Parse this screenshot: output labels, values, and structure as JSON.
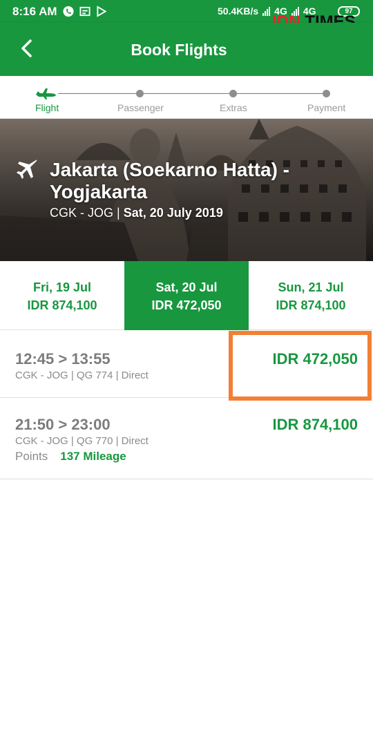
{
  "status_bar": {
    "time": "8:16 AM",
    "network_speed": "50.4KB/s",
    "network_type_1": "4G",
    "network_type_2": "4G",
    "battery": "97"
  },
  "watermark": {
    "part_a": "IDN",
    "part_b": "TIMES"
  },
  "header": {
    "title": "Book Flights",
    "back_icon": "chevron-left-icon"
  },
  "stepper": {
    "steps": [
      {
        "label": "Flight",
        "active": true
      },
      {
        "label": "Passenger",
        "active": false
      },
      {
        "label": "Extras",
        "active": false
      },
      {
        "label": "Payment",
        "active": false
      }
    ]
  },
  "route": {
    "title": "Jakarta (Soekarno Hatta) - Yogjakarta",
    "codes": "CGK - JOG",
    "separator": "|",
    "date": "Sat, 20 July 2019",
    "icon": "airplane-icon"
  },
  "date_tabs": [
    {
      "date": "Fri, 19 Jul",
      "price": "IDR 874,100",
      "selected": false
    },
    {
      "date": "Sat, 20 Jul",
      "price": "IDR 472,050",
      "selected": true
    },
    {
      "date": "Sun, 21 Jul",
      "price": "IDR 874,100",
      "selected": false
    }
  ],
  "flights": [
    {
      "time": "12:45 > 13:55",
      "details": "CGK - JOG | QG 774 | Direct",
      "price": "IDR 472,050"
    },
    {
      "time": "21:50 > 23:00",
      "details": "CGK - JOG | QG 770 | Direct",
      "price": "IDR 874,100",
      "points_label": "Points",
      "points_value": "137 Mileage"
    }
  ],
  "colors": {
    "brand_green": "#18973f",
    "highlight_orange": "#f28034",
    "text_gray": "#7c7c7c"
  }
}
